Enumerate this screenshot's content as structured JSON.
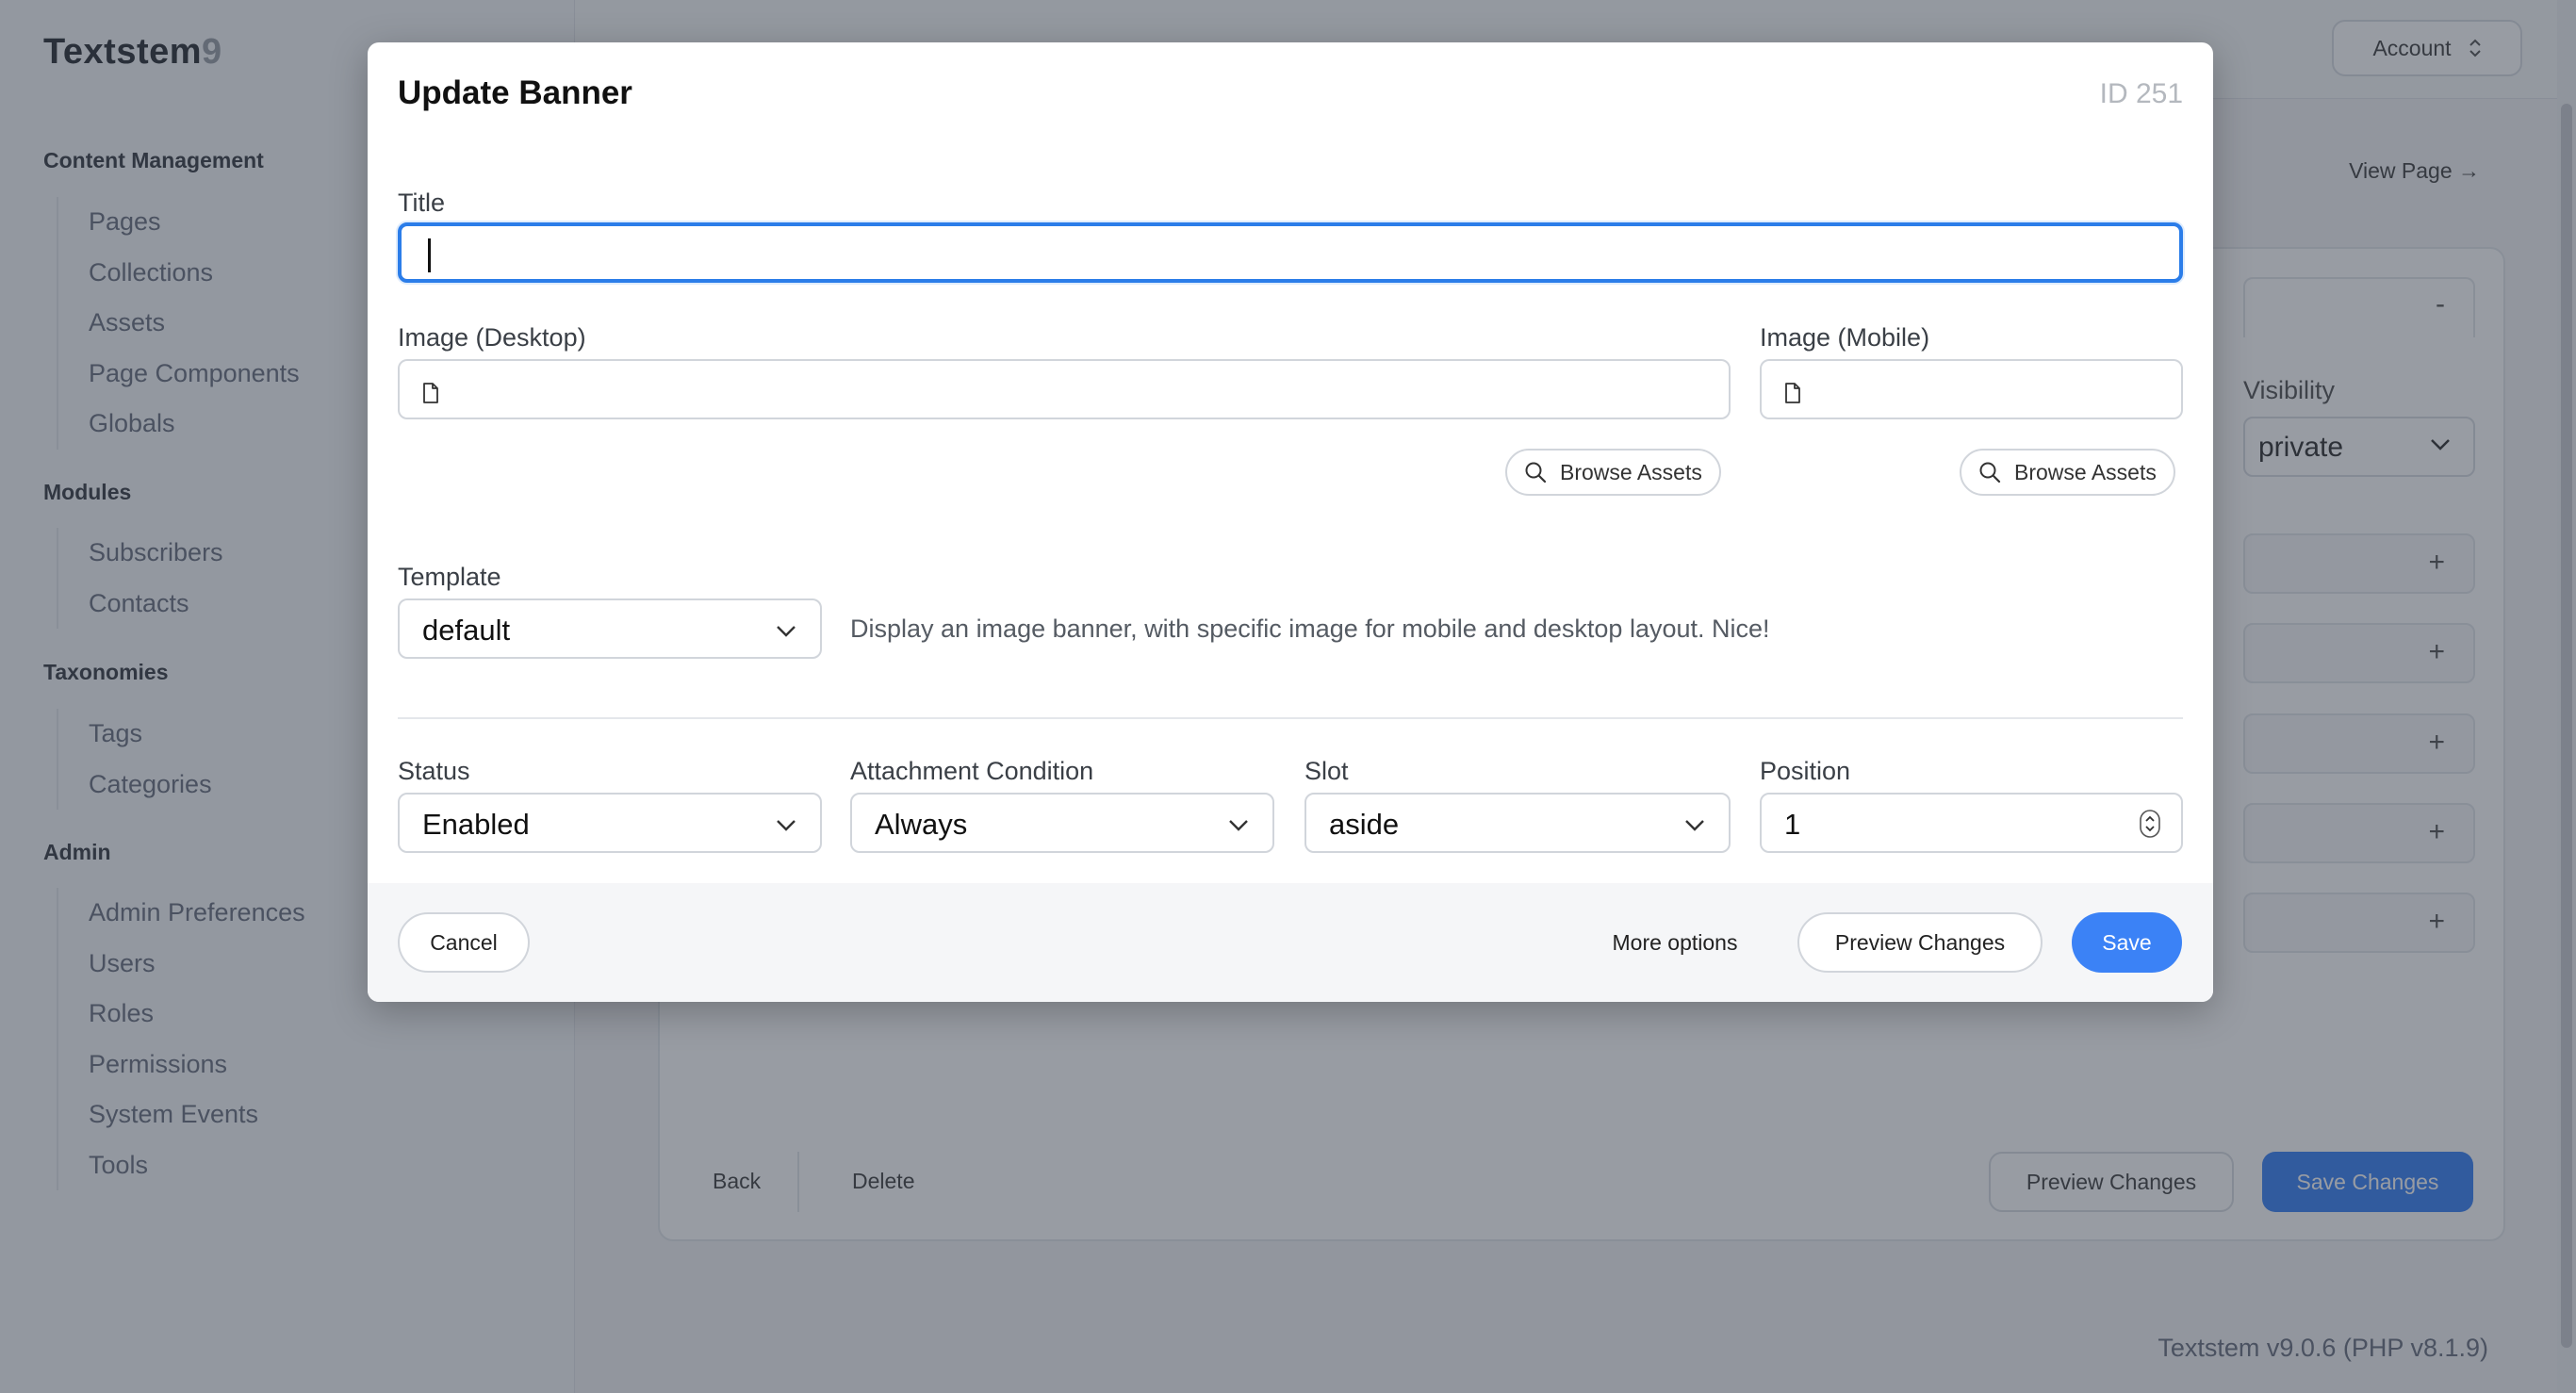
{
  "app": {
    "name": "Textstem",
    "name_suffix": "9",
    "version": "Textstem v9.0.6 (PHP v8.1.9)"
  },
  "sidebar": {
    "sections": [
      {
        "title": "Content Management",
        "items": [
          "Pages",
          "Collections",
          "Assets",
          "Page Components",
          "Globals"
        ]
      },
      {
        "title": "Modules",
        "items": [
          "Subscribers",
          "Contacts"
        ]
      },
      {
        "title": "Taxonomies",
        "items": [
          "Tags",
          "Categories"
        ]
      },
      {
        "title": "Admin",
        "items": [
          "Admin Preferences",
          "Users",
          "Roles",
          "Permissions",
          "System Events",
          "Tools"
        ]
      }
    ]
  },
  "header": {
    "account_label": "Account",
    "view_page_label": "View Page →"
  },
  "panel": {
    "collapse_symbol": "-",
    "visibility_label": "Visibility",
    "visibility_value": "private",
    "expand_symbol": "+",
    "back_label": "Back",
    "delete_label": "Delete",
    "preview_label": "Preview Changes",
    "save_label": "Save Changes"
  },
  "modal": {
    "title": "Update Banner",
    "id_label": "ID 251",
    "fields": {
      "title_label": "Title",
      "title_value": "",
      "image_desktop_label": "Image (Desktop)",
      "image_desktop_value": "",
      "image_mobile_label": "Image (Mobile)",
      "image_mobile_value": "",
      "browse_label": "Browse Assets",
      "template_label": "Template",
      "template_value": "default",
      "template_description": "Display an image banner, with specific image for mobile and desktop layout. Nice!",
      "status_label": "Status",
      "status_value": "Enabled",
      "attachment_label": "Attachment Condition",
      "attachment_value": "Always",
      "slot_label": "Slot",
      "slot_value": "aside",
      "position_label": "Position",
      "position_value": "1"
    },
    "footer": {
      "cancel_label": "Cancel",
      "more_options_label": "More options",
      "preview_label": "Preview Changes",
      "save_label": "Save"
    }
  },
  "colors": {
    "primary": "#3b82f6",
    "focus_ring": "#2b7de9",
    "overlay": "rgba(40,48,62,0.48)"
  },
  "icons": [
    "file-icon",
    "search-icon",
    "chevron-down-icon",
    "stepper-icon",
    "arrow-right-icon",
    "chevron-updown-icon"
  ]
}
